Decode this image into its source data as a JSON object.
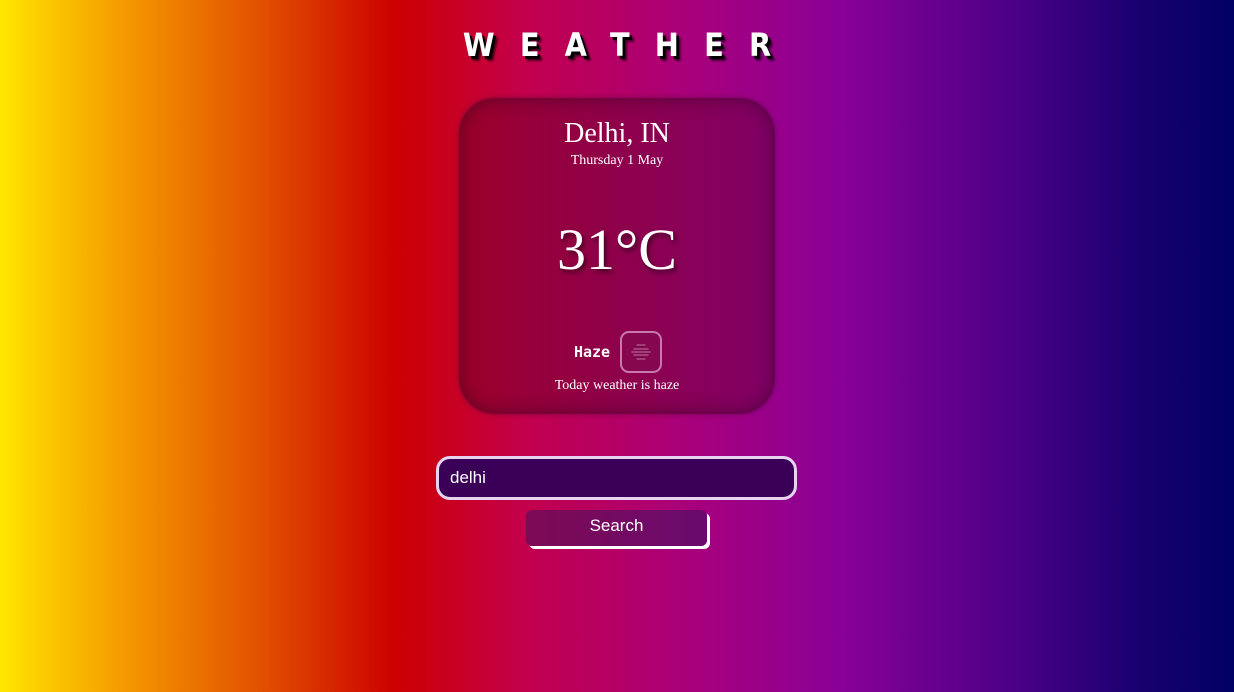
{
  "header": {
    "title": "WEATHER"
  },
  "weather_card": {
    "location": "Delhi, IN",
    "date": "Thursday 1 May",
    "temperature": "31°C",
    "condition": "Haze",
    "condition_icon": "haze-icon",
    "description": "Today weather is haze"
  },
  "search": {
    "value": "delhi",
    "placeholder": "",
    "button_label": "Search"
  },
  "colors": {
    "background_start": "#ffe600",
    "background_mid": "#cc0000",
    "background_end": "#000064",
    "input_background": "#3a0057"
  }
}
